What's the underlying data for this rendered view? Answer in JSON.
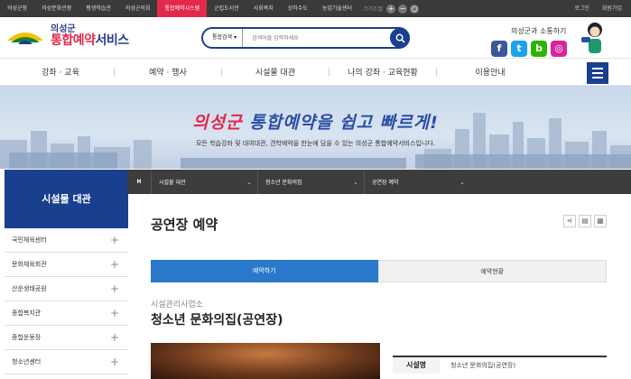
{
  "topbar": {
    "sites": [
      {
        "label": "의성군청",
        "active": false
      },
      {
        "label": "의성문화관광",
        "active": false
      },
      {
        "label": "평생학습관",
        "active": false
      },
      {
        "label": "의성군의회",
        "active": false
      },
      {
        "label": "통합예약시스템",
        "active": true
      },
      {
        "label": "군립도서관",
        "active": false
      },
      {
        "label": "사회복지",
        "active": false
      },
      {
        "label": "상하수도",
        "active": false
      },
      {
        "label": "농업기술센터",
        "active": false
      }
    ],
    "zoom_label": "크기조절",
    "zoom_in": "+",
    "zoom_out": "−",
    "zoom_reset": "○",
    "login": "로그인",
    "signup": "회원가입"
  },
  "header": {
    "logo_small": "의성군",
    "logo_big_accent": "통합예약",
    "logo_big_rest": "서비스",
    "search": {
      "category": "통합검색",
      "placeholder": "검색어를 입력하세요"
    },
    "social_title": "의성군과 소통하기",
    "social_icons": [
      {
        "name": "facebook-icon",
        "glyph": "f",
        "color": "#3b5998"
      },
      {
        "name": "twitter-icon",
        "glyph": "t",
        "color": "#1da1f2"
      },
      {
        "name": "blog-icon",
        "glyph": "b",
        "color": "#2db400"
      },
      {
        "name": "instagram-icon",
        "glyph": "◎",
        "color": "#d6249f"
      }
    ]
  },
  "gnb": {
    "items": [
      "강좌 · 교육",
      "예약 · 행사",
      "시설물 대관",
      "나의 강좌 · 교육현황",
      "이용안내"
    ]
  },
  "banner": {
    "title_pre": "의성군 ",
    "title_accent": "통합예약",
    "title_post": "을 쉽고 빠르게!",
    "subtitle": "모든 학습강좌 및 대여대관, 견학예약을 한눈에 담을 수 있는 의성군 통합예약서비스입니다."
  },
  "sidebar": {
    "title": "시설물 대관",
    "items": [
      "국민체육센터",
      "문화체육회관",
      "산운생태공원",
      "종합복지관",
      "종합운동장",
      "청소년센터"
    ]
  },
  "breadcrumb": {
    "home": "H",
    "items": [
      "시설물 대관",
      "청소년 문화의집",
      "공연장 예약"
    ]
  },
  "page": {
    "title": "공연장 예약",
    "tabs": [
      {
        "label": "예약하기",
        "active": true
      },
      {
        "label": "예약현황",
        "active": false
      }
    ],
    "org": "시설관리사업소",
    "venue": "청소년 문화의집(공연장)",
    "info_label": "시설명",
    "info_value": "청소년 문화의집(공연장)"
  },
  "colors": {
    "primary": "#1b3f8f",
    "accent": "#e2294a",
    "tab_active": "#2a78c9"
  }
}
